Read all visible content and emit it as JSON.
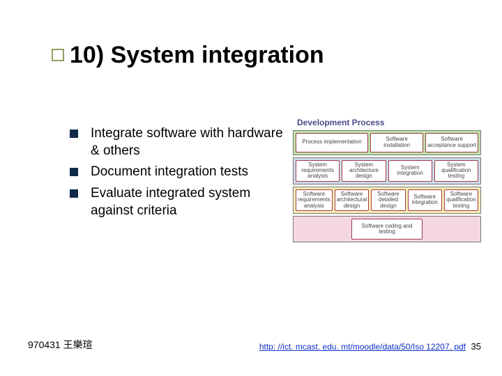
{
  "title": "10) System integration",
  "bullets": [
    "Integrate software with hardware & others",
    "Document integration tests",
    "Evaluate integrated system against criteria"
  ],
  "diagram": {
    "heading": "Development Process",
    "row1": {
      "cells": [
        "Process implementation",
        "Software installation",
        "Software acceptance support"
      ]
    },
    "row2": {
      "cells": [
        "System requirements analysis",
        "System architecture design",
        "System integration",
        "System qualification testing"
      ]
    },
    "row3": {
      "cells": [
        "Software requirements analysis",
        "Software architectural design",
        "Software detailed design",
        "Software integration",
        "Software qualification testing"
      ]
    },
    "row4": {
      "cell": "Software coding and testing"
    }
  },
  "footer": {
    "author": "970431 王樂瑄",
    "url": "http: //ict. mcast. edu. mt/moodle/data/50/Iso 12207. pdf",
    "page": "35"
  }
}
